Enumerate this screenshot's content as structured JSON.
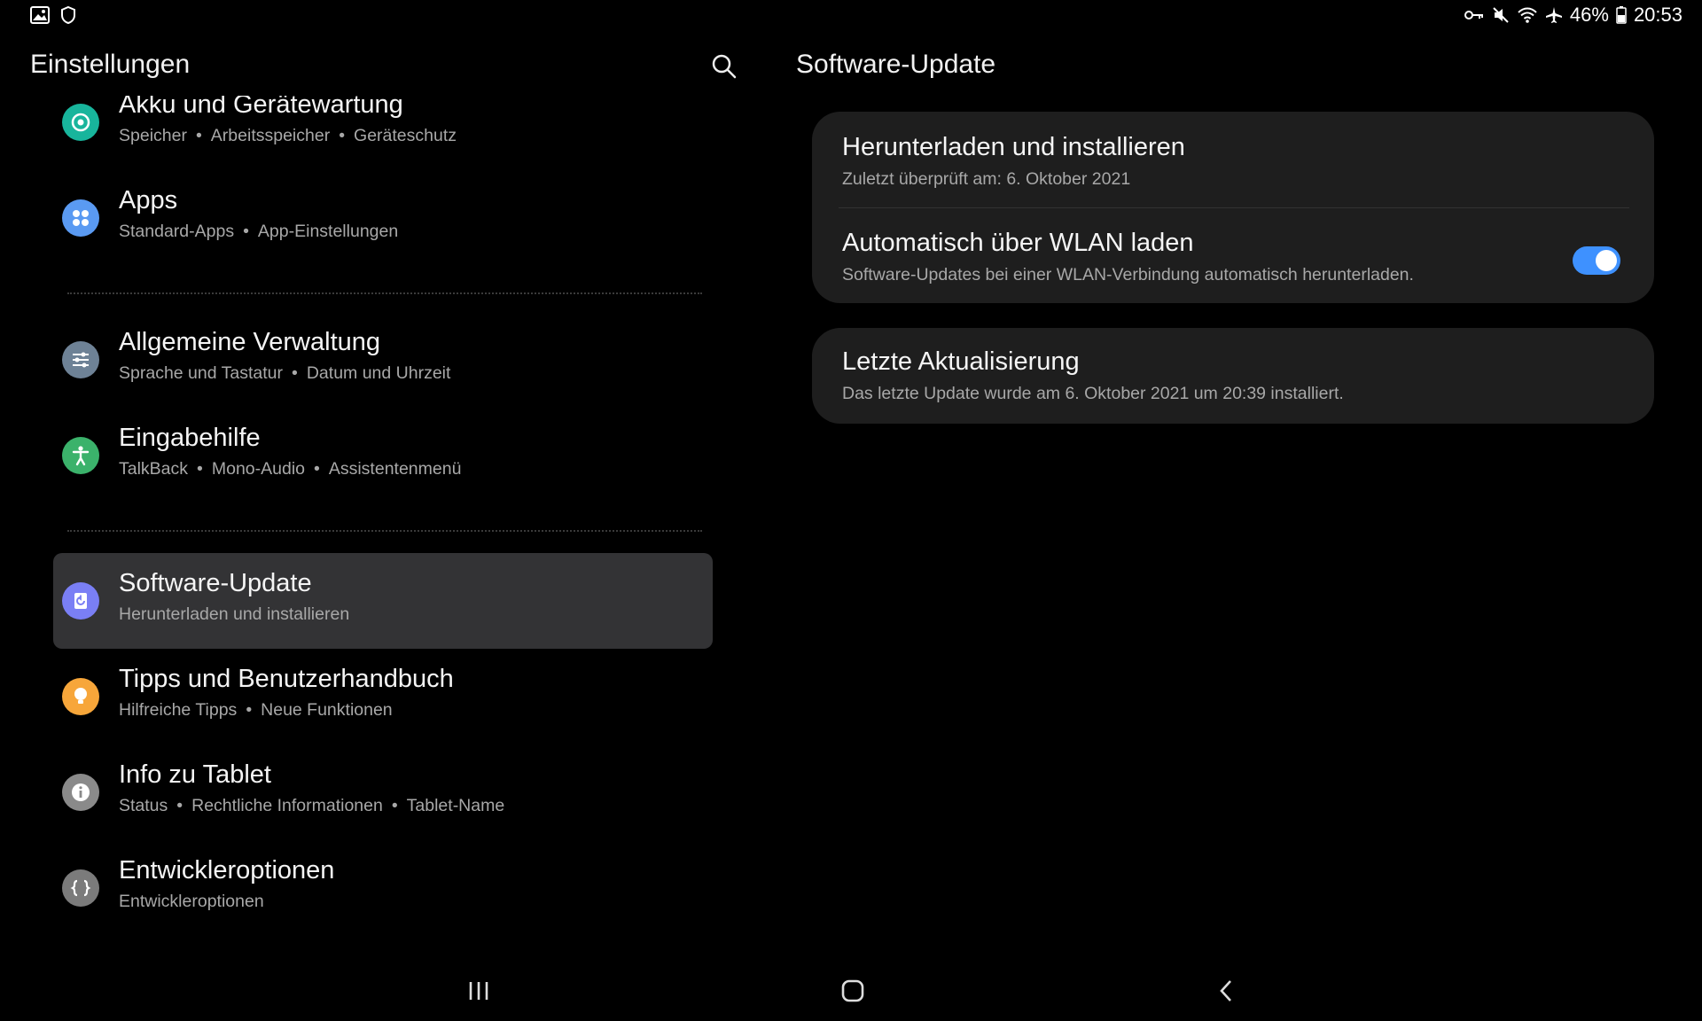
{
  "status_bar": {
    "left_icons": [
      "gallery-icon",
      "shield-icon"
    ],
    "right_icons": [
      "key-icon",
      "mute-icon",
      "wifi-icon",
      "airplane-icon",
      "battery-icon"
    ],
    "battery": "46%",
    "time": "20:53"
  },
  "left_panel": {
    "title": "Einstellungen",
    "search_icon": "search-icon",
    "items": [
      {
        "title": "Akku und Gerätewartung",
        "subs": [
          "Speicher",
          "Arbeitsspeicher",
          "Geräteschutz"
        ],
        "icon": "device-care-icon",
        "color": "#18b59c"
      },
      {
        "title": "Apps",
        "subs": [
          "Standard-Apps",
          "App-Einstellungen"
        ],
        "icon": "apps-icon",
        "color": "#5a9af2"
      },
      {
        "title": "Allgemeine Verwaltung",
        "subs": [
          "Sprache und Tastatur",
          "Datum und Uhrzeit"
        ],
        "icon": "general-management-icon",
        "color": "#6e8296"
      },
      {
        "title": "Eingabehilfe",
        "subs": [
          "TalkBack",
          "Mono-Audio",
          "Assistentenmenü"
        ],
        "icon": "accessibility-icon",
        "color": "#3bb26b"
      },
      {
        "title": "Software-Update",
        "subs": [
          "Herunterladen und installieren"
        ],
        "icon": "software-update-icon",
        "color": "#7a7ff5",
        "selected": true
      },
      {
        "title": "Tipps und Benutzerhandbuch",
        "subs": [
          "Hilfreiche Tipps",
          "Neue Funktionen"
        ],
        "icon": "tips-icon",
        "color": "#f7a63a"
      },
      {
        "title": "Info zu Tablet",
        "subs": [
          "Status",
          "Rechtliche Informationen",
          "Tablet-Name"
        ],
        "icon": "info-icon",
        "color": "#8a8a8a"
      },
      {
        "title": "Entwickleroptionen",
        "subs": [
          "Entwickleroptionen"
        ],
        "icon": "developer-options-icon",
        "color": "#7b7b7b"
      }
    ]
  },
  "right_panel": {
    "title": "Software-Update",
    "card1": {
      "download_title": "Herunterladen und installieren",
      "download_sub": "Zuletzt überprüft am: 6. Oktober 2021",
      "auto_title": "Automatisch über WLAN laden",
      "auto_sub": "Software-Updates bei einer WLAN-Verbindung automatisch herunterladen.",
      "auto_enabled": true,
      "toggle_color": "#3e91ff"
    },
    "card2": {
      "title": "Letzte Aktualisierung",
      "sub": "Das letzte Update wurde am 6. Oktober 2021 um 20:39 installiert."
    }
  },
  "nav_bar": {
    "recents": "recents-icon",
    "home": "home-icon",
    "back": "back-icon"
  }
}
